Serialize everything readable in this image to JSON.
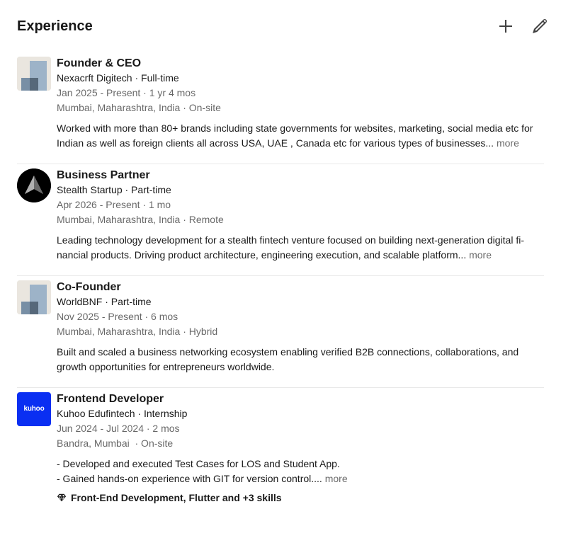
{
  "section": {
    "title": "Experience",
    "add_icon": "plus-icon",
    "edit_icon": "pencil-icon"
  },
  "entries": [
    {
      "logo": "generic-company-logo",
      "title": "Founder & CEO",
      "company": "Nexacrft Digitech · Full-time",
      "dates": "Jan 2025 - Present · 1 yr 4 mos",
      "location": "Mumbai, Maharashtra, India · On-site",
      "description": "Worked with more than 80+ brands including state governments for websites, marketing, social media etc for Indian as well as foreign clients all across USA, UAE , Canada etc for various types of businesses...",
      "more": "more"
    },
    {
      "logo": "stealth-startup-logo",
      "title": "Business Partner",
      "company": "Stealth Startup · Part-time",
      "dates": "Apr 2026 - Present · 1 mo",
      "location": "Mumbai, Maharashtra, India · Remote",
      "description": "Leading technology development for a stealth fintech venture focused on building next-generation digital fi­nancial products. Driving product architecture, engineering execution, and scalable platform...",
      "more": "more"
    },
    {
      "logo": "generic-company-logo",
      "title": "Co-Founder",
      "company": "WorldBNF · Part-time",
      "dates": "Nov 2025 - Present · 6 mos",
      "location": "Mumbai, Maharashtra, India · Hybrid",
      "description": "Built and scaled a business networking ecosystem enabling verified B2B connections, collaborations, and growth opportunities for entrepreneurs worldwide."
    },
    {
      "logo": "kuhoo-logo",
      "logo_text": "kuhoo",
      "title": "Frontend Developer",
      "company": "Kuhoo Edufintech · Internship",
      "dates": "Jun 2024 - Jul 2024 · 2 mos",
      "location": "Bandra, Mumbai  · On-site",
      "description_line1": "- Developed and executed Test Cases for LOS and Student App.",
      "description_line2": "- Gained hands-on experience with GIT for version control....",
      "more": "more",
      "skills": "Front-End Development, Flutter and +3 skills"
    }
  ]
}
